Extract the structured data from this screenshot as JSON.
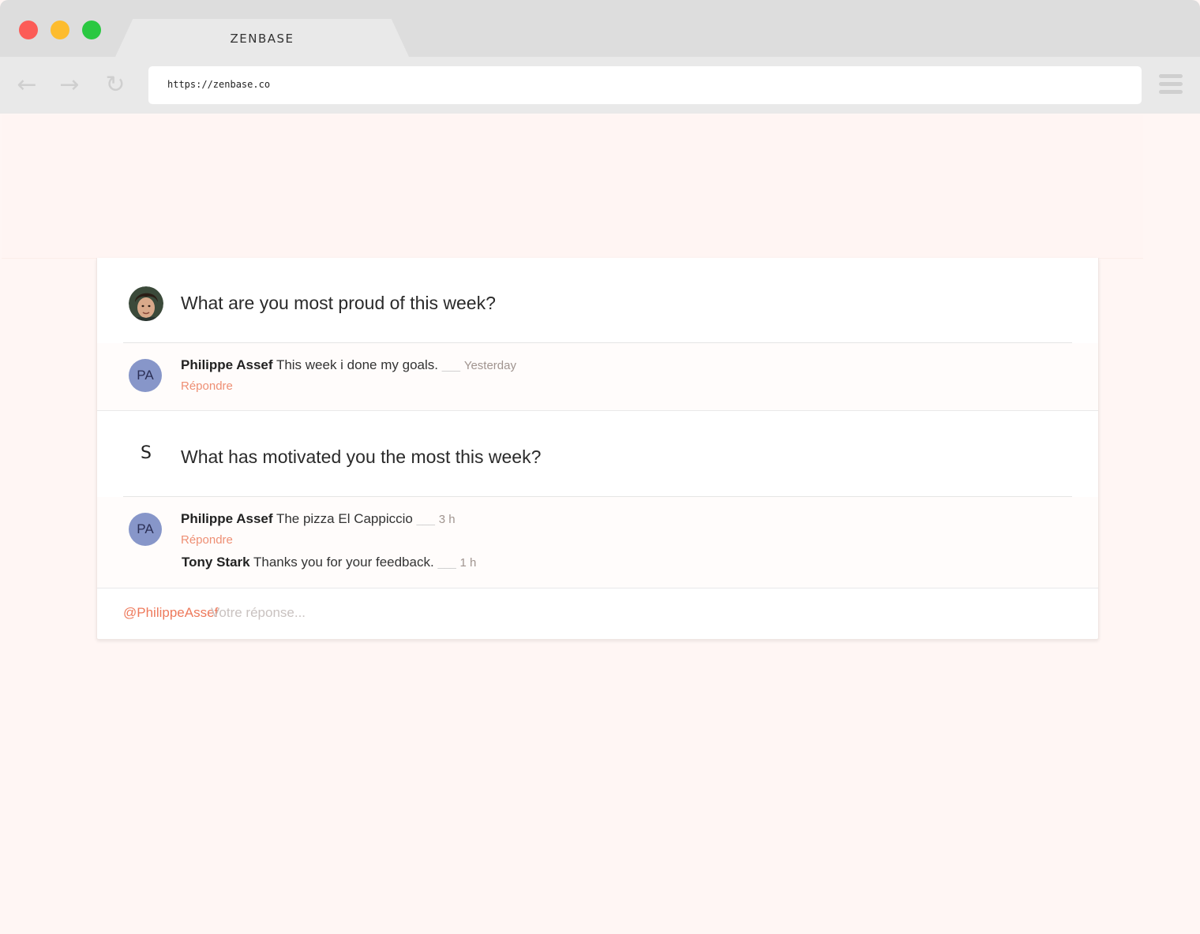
{
  "browser": {
    "tab_title": "ZENBASE",
    "url": "https://zenbase.co",
    "back_icon": "arrow-left-icon",
    "forward_icon": "arrow-right-icon",
    "reload_icon": "reload-icon",
    "menu_icon": "hamburger-menu-icon",
    "back_glyph": "←",
    "forward_glyph": "→",
    "reload_glyph": "↻"
  },
  "questions": [
    {
      "avatar_type": "photo",
      "text": "What are you most proud of this week?",
      "answers": [
        {
          "initials": "PA",
          "author": "Philippe Assef",
          "text": "This week i done my goals.",
          "separator": "___",
          "time": "Yesterday",
          "reply_label": "Répondre"
        }
      ]
    },
    {
      "avatar_letter": "S",
      "text": "What has motivated you the most this week?",
      "answers": [
        {
          "initials": "PA",
          "author": "Philippe Assef",
          "text": "The pizza El Cappiccio",
          "separator": "___",
          "time": "3 h",
          "reply_label": "Répondre",
          "replies": [
            {
              "author": "Tony Stark",
              "text": "Thanks you for your feedback.",
              "separator": "___",
              "time": "1 h"
            }
          ]
        }
      ]
    }
  ],
  "reply_box": {
    "mention": "@PhilippeAssef",
    "placeholder": "Votre réponse..."
  },
  "colors": {
    "page_bg": "#fff6f4",
    "accent": "#ee7a5c",
    "avatar_bg": "#8796c9",
    "traffic_red": "#fc5c57",
    "traffic_yellow": "#fdbc2e",
    "traffic_green": "#2ac841"
  }
}
